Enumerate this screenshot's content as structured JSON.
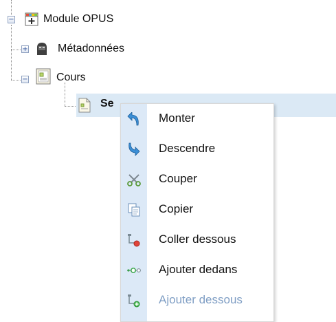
{
  "tree": {
    "root": {
      "label": "Module OPUS",
      "expander": "−"
    },
    "metadata": {
      "label": "Métadonnées",
      "expander": "+"
    },
    "course": {
      "label": "Cours",
      "expander": "−"
    },
    "section": {
      "label": "Section 1",
      "visible_text": "Se"
    }
  },
  "context_menu": {
    "items": [
      {
        "label": "Monter",
        "icon": "move-up-icon",
        "enabled": true
      },
      {
        "label": "Descendre",
        "icon": "move-down-icon",
        "enabled": true
      },
      {
        "label": "Couper",
        "icon": "scissors-icon",
        "enabled": true
      },
      {
        "label": "Copier",
        "icon": "copy-icon",
        "enabled": true
      },
      {
        "label": "Coller dessous",
        "icon": "paste-below-icon",
        "enabled": true
      },
      {
        "label": "Ajouter dedans",
        "icon": "add-inside-icon",
        "enabled": true
      },
      {
        "label": "Ajouter dessous",
        "icon": "add-below-icon",
        "enabled": false
      }
    ]
  },
  "colors": {
    "selection": "#dbe9f5",
    "menu_gutter": "#dce9f7",
    "disabled_text": "#7f9ec4"
  }
}
